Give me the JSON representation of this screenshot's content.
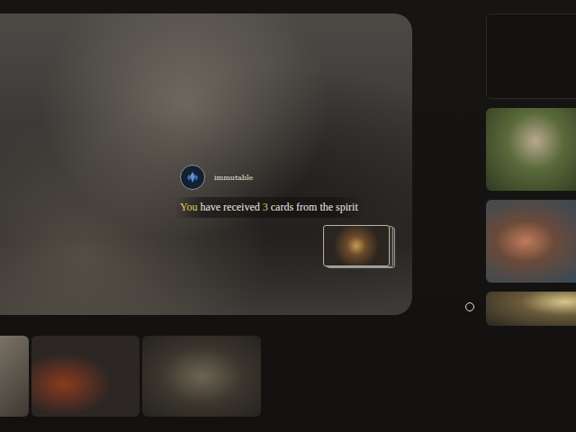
{
  "notification": {
    "sender": "immutable",
    "message": [
      {
        "text": "You",
        "highlight": true
      },
      {
        "text": " have received ",
        "highlight": false
      },
      {
        "text": "3",
        "highlight": true
      },
      {
        "text": " cards from the spirit",
        "highlight": false
      }
    ]
  }
}
